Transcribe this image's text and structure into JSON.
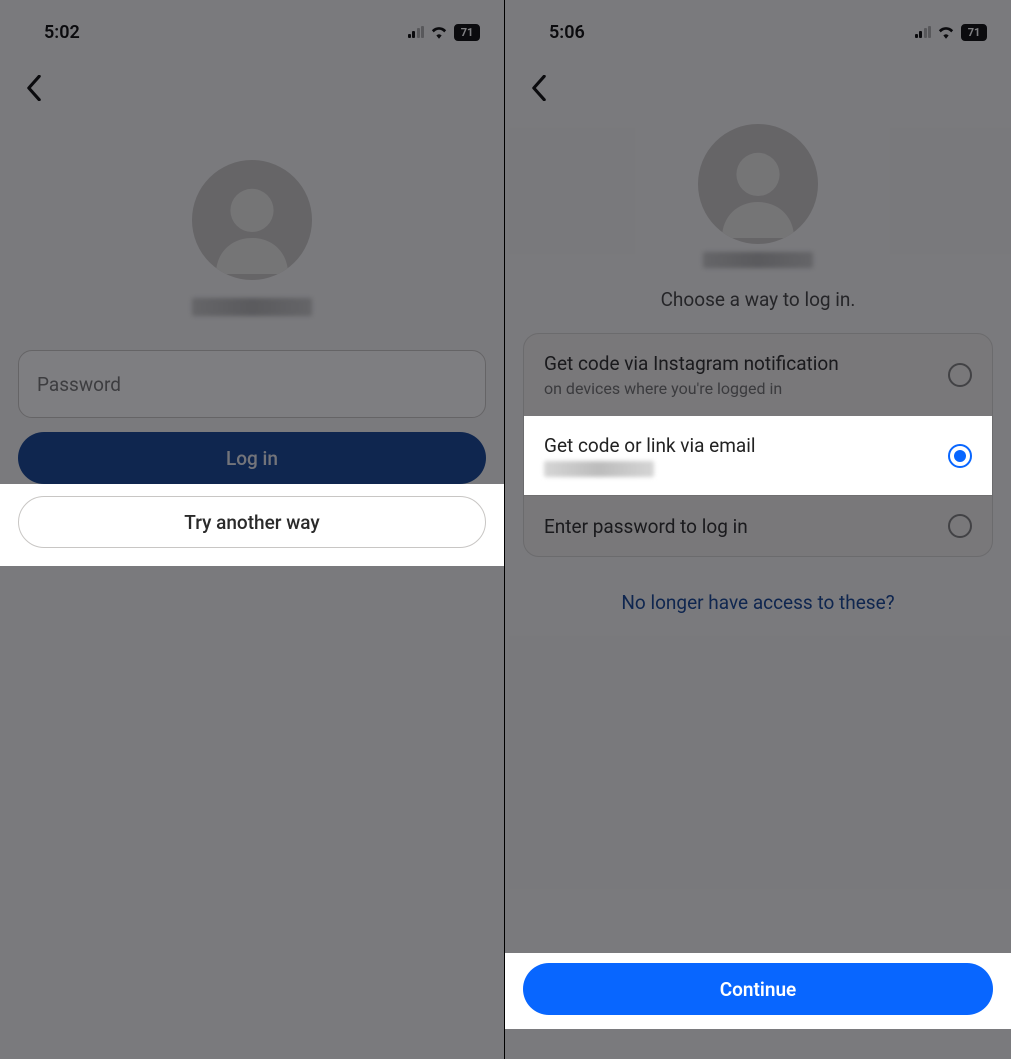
{
  "left": {
    "status": {
      "time": "5:02",
      "battery": "71"
    },
    "password_placeholder": "Password",
    "login_label": "Log in",
    "try_another_label": "Try another way"
  },
  "right": {
    "status": {
      "time": "5:06",
      "battery": "71"
    },
    "subtitle": "Choose a way to log in.",
    "options": [
      {
        "title": "Get code via Instagram notification",
        "sub": "on devices where you're logged in",
        "selected": false
      },
      {
        "title": "Get code or link via email",
        "sub_blurred": true,
        "selected": true
      },
      {
        "title": "Enter password to log in",
        "selected": false
      }
    ],
    "no_access_label": "No longer have access to these?",
    "continue_label": "Continue"
  }
}
